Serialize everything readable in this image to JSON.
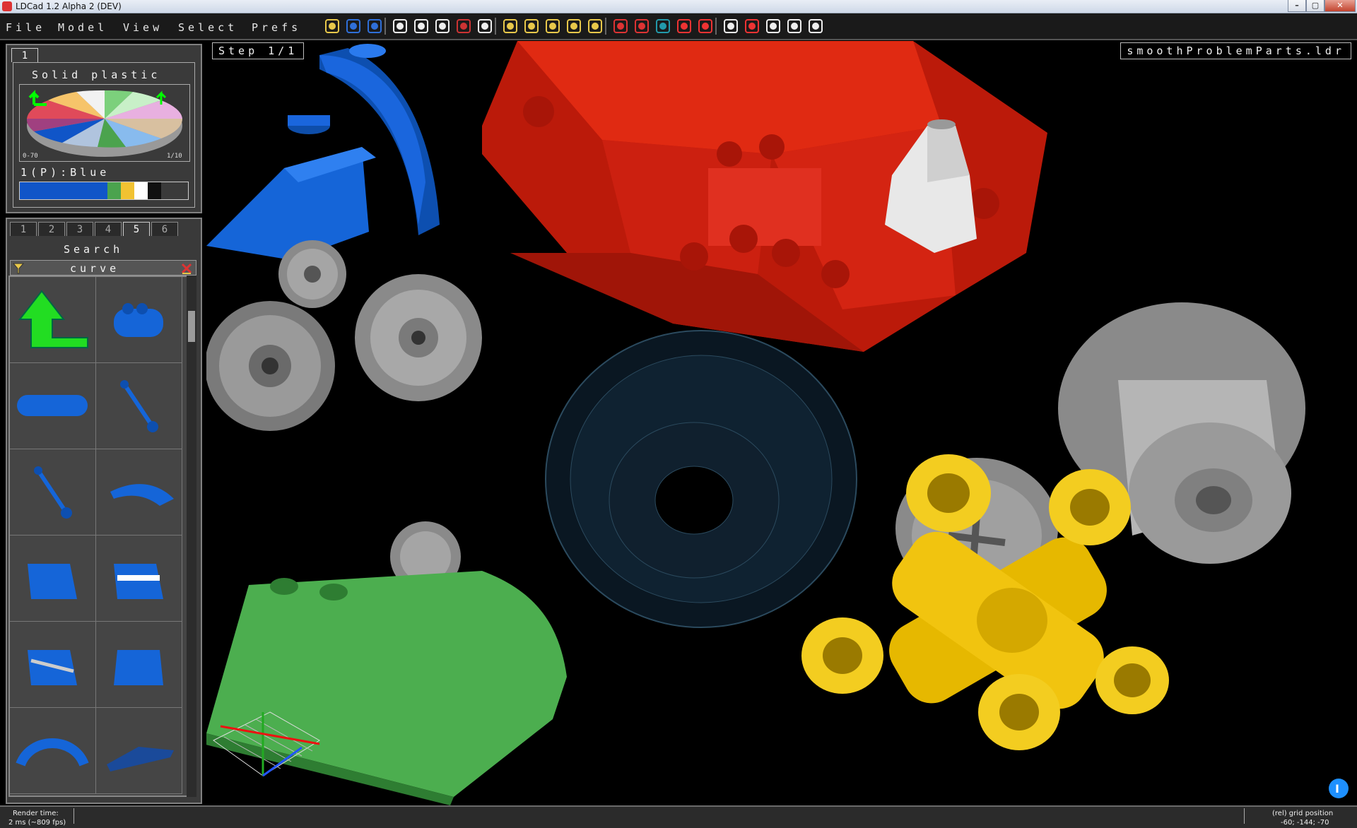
{
  "window": {
    "title": "LDCad 1.2 Alpha 2 (DEV)",
    "minimize": "–",
    "maximize": "▢",
    "close": "✕"
  },
  "menu": [
    "File",
    "Model",
    "View",
    "Select",
    "Prefs"
  ],
  "toolbar_icons": [
    "open-icon",
    "save-icon",
    "save-all-icon",
    "undo-icon",
    "redo-icon",
    "copy-icon",
    "cut-icon",
    "paste-icon",
    "first-step-icon",
    "prev-step-icon",
    "next-step-icon",
    "last-step-icon",
    "add-step-icon",
    "model-icon",
    "submodel-icon",
    "grid-icon",
    "heart-icon",
    "heart-broken-icon",
    "move-icon",
    "rotate-icon",
    "pan-icon",
    "zoom-icon",
    "grid-dots-icon"
  ],
  "color_panel": {
    "tabs": [
      "1"
    ],
    "active_tab": 0,
    "material": "Solid plastic",
    "range_left": "0-70",
    "range_right": "1/10",
    "selected_color": "1(P):Blue",
    "swatches": [
      "#1055c8",
      "#4ba34e",
      "#f1c232",
      "#ffffff",
      "#101010"
    ]
  },
  "parts_panel": {
    "tabs": [
      "1",
      "2",
      "3",
      "4",
      "5",
      "6"
    ],
    "active_tab": 4,
    "search_label": "Search",
    "search_value": "curve",
    "filter_icon": "filter-icon",
    "clear_icon": "clear-search-icon"
  },
  "viewport": {
    "step_label": "Step 1/1",
    "file_name": "smoothProblemParts.ldr"
  },
  "status": {
    "render_label": "Render time:",
    "render_value": "2 ms (~809 fps)",
    "grid_label": "(rel) grid position",
    "grid_value": "-60; -144; -70"
  }
}
